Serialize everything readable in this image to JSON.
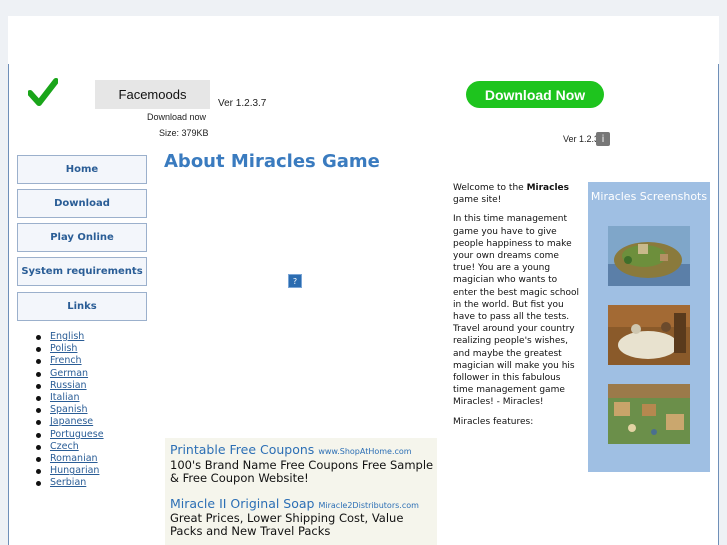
{
  "header": {
    "product_name": "Facemoods",
    "version_left": "Ver 1.2.3.7",
    "download_now_small": "Download now",
    "size": "Size: 379KB",
    "download_now_button": "Download Now",
    "version_right": "Ver 1.2.3",
    "info_glyph": "i"
  },
  "nav": {
    "items": [
      "Home",
      "Download",
      "Play Online",
      "System requirements",
      "Links"
    ]
  },
  "languages": [
    "English",
    "Polish",
    "French",
    "German",
    "Russian",
    "Italian",
    "Spanish",
    "Japanese",
    "Portuguese",
    "Czech",
    "Romanian",
    "Hungarian",
    "Serbian"
  ],
  "main": {
    "title": "About Miracles Game",
    "help_glyph": "?"
  },
  "ads": [
    {
      "title": "Printable Free Coupons",
      "url": "www.ShopAtHome.com",
      "body": "100's Brand Name Free Coupons Free Sample & Free Coupon Website!"
    },
    {
      "title": "Miracle II Original Soap",
      "url": "Miracle2Distributors.com",
      "body": "Great Prices, Lower Shipping Cost, Value Packs and New Travel Packs"
    }
  ],
  "welcome": {
    "intro_before": "Welcome to the ",
    "intro_bold": "Miracles",
    "intro_after": " game site!",
    "paragraph": "In this time management game you have to give people happiness to make your own dreams come true! You are a young magician who wants to enter the best magic school in the world. But fist you have to pass all the tests. Travel around your country realizing people's wishes, and maybe the greatest magician will make you his follower in this fabulous time management game Miracles! - Miracles!",
    "features": "Miracles features:"
  },
  "screenshots": {
    "title": "Miracles Screenshots"
  },
  "colors": {
    "accent": "#3a7bbf",
    "download_green": "#1ec41e",
    "panel_blue": "#9fbfe3"
  },
  "icons": [
    "checkmark-icon",
    "info-icon",
    "help-icon"
  ]
}
